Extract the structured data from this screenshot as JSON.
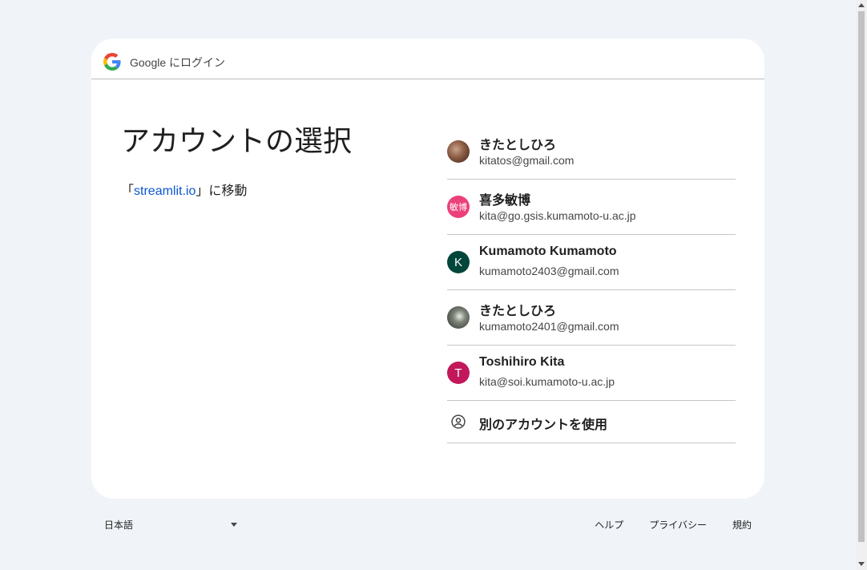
{
  "header": {
    "title": "Google にログイン",
    "logo_icon": "google-g-icon"
  },
  "main": {
    "heading": "アカウントの選択",
    "subtitle_prefix": "「",
    "subtitle_link": "streamlit.io",
    "subtitle_suffix": "」に移動"
  },
  "accounts": [
    {
      "name": "きたとしひろ",
      "email": "kitatos@gmail.com",
      "avatar": "photo",
      "avatar_text": ""
    },
    {
      "name": "喜多敏博",
      "email": "kita@go.gsis.kumamoto-u.ac.jp",
      "avatar": "letter",
      "avatar_text": "敏博",
      "avatar_color": "#ec407a"
    },
    {
      "name": "Kumamoto Kumamoto",
      "email": "kumamoto2403@gmail.com",
      "avatar": "letter",
      "avatar_text": "K",
      "avatar_color": "#00463a"
    },
    {
      "name": "きたとしひろ",
      "email": "kumamoto2401@gmail.com",
      "avatar": "photo",
      "avatar_text": ""
    },
    {
      "name": "Toshihiro Kita",
      "email": "kita@soi.kumamoto-u.ac.jp",
      "avatar": "letter",
      "avatar_text": "T",
      "avatar_color": "#c2185b"
    }
  ],
  "other_account": {
    "label": "別のアカウントを使用",
    "icon": "account-circle-icon"
  },
  "footer": {
    "language": "日本語",
    "links": {
      "help": "ヘルプ",
      "privacy": "プライバシー",
      "terms": "規約"
    }
  },
  "colors": {
    "background": "#f0f4f9",
    "link": "#0b57d0",
    "card": "#ffffff"
  }
}
